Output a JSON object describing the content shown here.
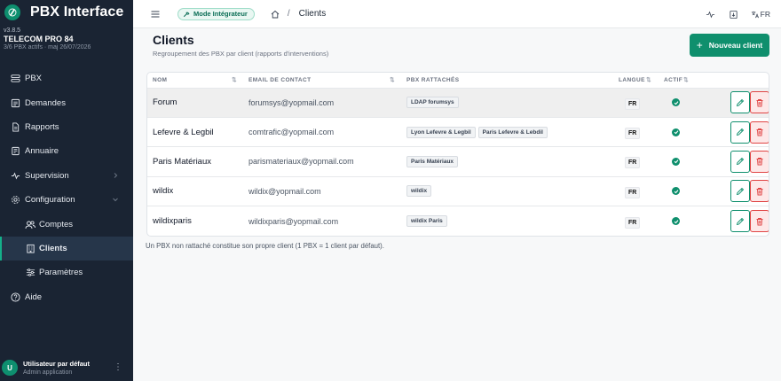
{
  "brand": {
    "name": "PBX Interface"
  },
  "meta": {
    "version": "v3.8.5",
    "org": "TELECOM PRO 84",
    "subtitle": "3/6 PBX actifs · maj 26/07/2026"
  },
  "sidebar": {
    "items": [
      {
        "label": "PBX",
        "icon": "pbx-icon"
      },
      {
        "label": "Demandes",
        "icon": "demandes-icon"
      },
      {
        "label": "Rapports",
        "icon": "rapports-icon"
      },
      {
        "label": "Annuaire",
        "icon": "annuaire-icon"
      },
      {
        "label": "Supervision",
        "icon": "supervision-icon"
      },
      {
        "label": "Configuration",
        "icon": "gear-icon"
      },
      {
        "label": "Comptes",
        "icon": "users-icon"
      },
      {
        "label": "Clients",
        "icon": "building-icon"
      },
      {
        "label": "Paramètres",
        "icon": "sliders-icon"
      },
      {
        "label": "Aide",
        "icon": "help-icon"
      }
    ]
  },
  "user": {
    "initial": "U",
    "name": "Utilisateur par défaut",
    "role": "Admin application"
  },
  "topbar": {
    "mode": "Mode Intégrateur",
    "breadcrumb": "Clients",
    "lang": "FR"
  },
  "page": {
    "title": "Clients",
    "subtitle": "Regroupement des PBX par client (rapports d'interventions)",
    "new_button": "Nouveau client",
    "note": "Un PBX non rattaché constitue son propre client (1 PBX = 1 client par défaut)."
  },
  "table": {
    "headers": {
      "nom": "NOM",
      "email": "EMAIL DE CONTACT",
      "pbx": "PBX RATTACHÉS",
      "langue": "LANGUE",
      "actif": "ACTIF"
    },
    "rows": [
      {
        "nom": "Forum",
        "email": "forumsys@yopmail.com",
        "pbx": [
          "LDAP forumsys"
        ],
        "langue": "FR",
        "actif": true
      },
      {
        "nom": "Lefevre & Legbil",
        "email": "comtrafic@yopmail.com",
        "pbx": [
          "Lyon Lefevre & Legbil",
          "Paris Lefevre & Lebdil"
        ],
        "langue": "FR",
        "actif": true
      },
      {
        "nom": "Paris Matériaux",
        "email": "parismateriaux@yopmail.com",
        "pbx": [
          "Paris Matériaux"
        ],
        "langue": "FR",
        "actif": true
      },
      {
        "nom": "wildix",
        "email": "wildix@yopmail.com",
        "pbx": [
          "wildix"
        ],
        "langue": "FR",
        "actif": true
      },
      {
        "nom": "wildixparis",
        "email": "wildixparis@yopmail.com",
        "pbx": [
          "wildix Paris"
        ],
        "langue": "FR",
        "actif": true
      }
    ]
  },
  "colors": {
    "accent": "#0f8f6d",
    "sidebar_bg": "#1a2433",
    "danger": "#e04444"
  }
}
